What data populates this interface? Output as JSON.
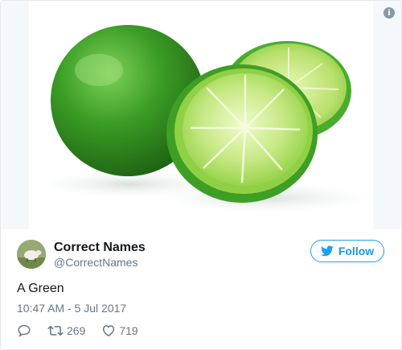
{
  "media": {
    "alt": "Two limes, one whole and one cut in half",
    "info_label": "i"
  },
  "author": {
    "name": "Correct Names",
    "handle": "@CorrectNames"
  },
  "follow_label": "Follow",
  "tweet": {
    "text": "A Green",
    "timestamp": "10:47 AM - 5 Jul 2017"
  },
  "actions": {
    "reply_icon": "reply-icon",
    "retweet_count": "269",
    "like_count": "719"
  },
  "colors": {
    "brand_blue": "#1da1f2",
    "text_secondary": "#657786",
    "lime_green": "#3fa32a"
  }
}
